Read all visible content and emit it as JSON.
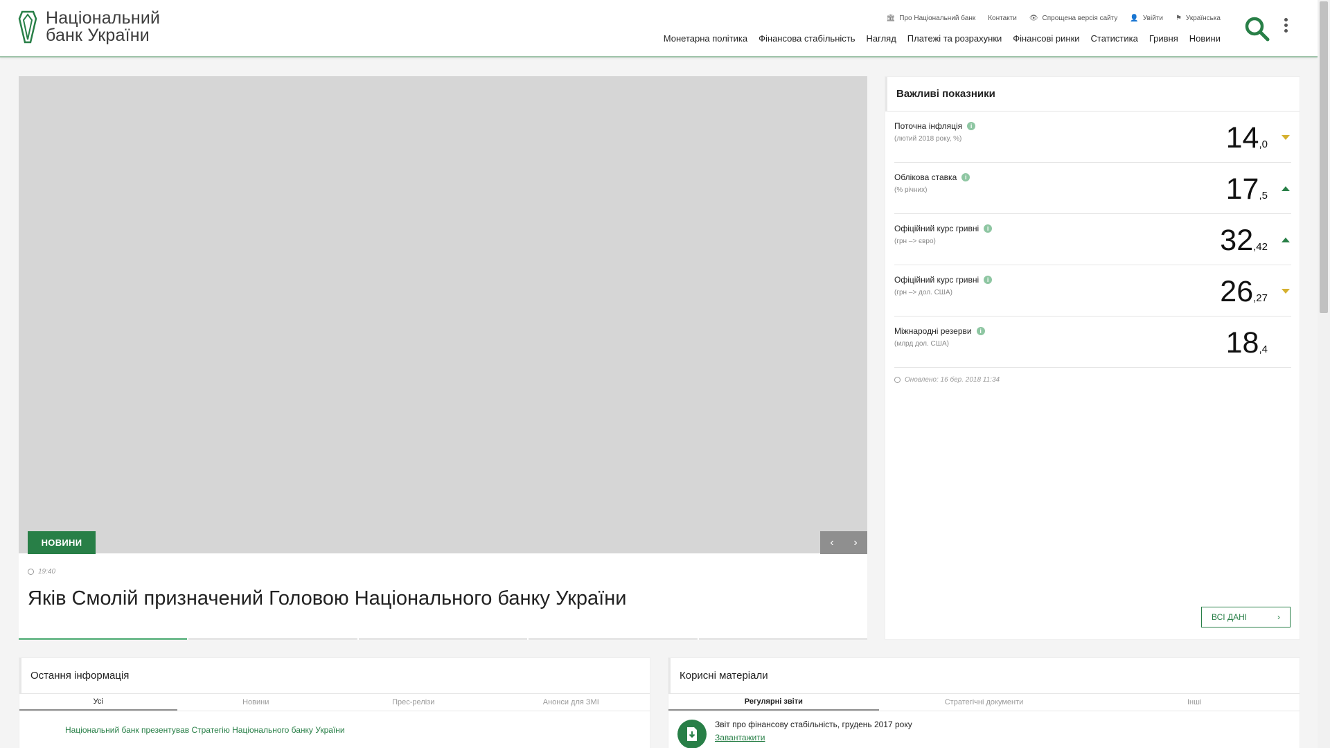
{
  "header": {
    "logo_line1": "Національний",
    "logo_line2": "банк України",
    "top_links": [
      {
        "icon": "bank-icon",
        "label": "Про Національний банк"
      },
      {
        "icon": "",
        "label": "Контакти"
      },
      {
        "icon": "eye-icon",
        "label": "Спрощена версія сайту"
      },
      {
        "icon": "user-icon",
        "label": "Увійти"
      },
      {
        "icon": "flag-icon",
        "label": "Українська"
      }
    ],
    "nav": [
      "Монетарна політика",
      "Фінансова стабільність",
      "Нагляд",
      "Платежі та розрахунки",
      "Фінансові ринки",
      "Статистика",
      "Гривня",
      "Новини"
    ]
  },
  "slider": {
    "badge": "НОВИНИ",
    "time": "19:40",
    "title": "Яків Смолій призначений Головою Національного банку України",
    "prev": "‹",
    "next": "›"
  },
  "indicators": {
    "title": "Важливі показники",
    "items": [
      {
        "label": "Поточна інфляція",
        "sub": "(лютий 2018 року, %)",
        "int": "14",
        "dec": ",0",
        "trend": "down"
      },
      {
        "label": "Облікова ставка",
        "sub": "(% річних)",
        "int": "17",
        "dec": ",5",
        "trend": "up"
      },
      {
        "label": "Офіційний курс гривні",
        "sub": "(грн –> євро)",
        "int": "32",
        "dec": ",42",
        "trend": "up"
      },
      {
        "label": "Офіційний курс гривні",
        "sub": "(грн –> дол. США)",
        "int": "26",
        "dec": ",27",
        "trend": "down"
      },
      {
        "label": "Міжнародні резерви",
        "sub": "(млрд дол. США)",
        "int": "18",
        "dec": ",4",
        "trend": "none"
      }
    ],
    "updated": "Оновлено: 16 бер. 2018 11:34",
    "all_data": "ВСІ ДАНІ",
    "all_data_arrow": "›"
  },
  "latest": {
    "title": "Остання інформація",
    "tabs": [
      "Усі",
      "Новини",
      "Прес-релізи",
      "Анонси для ЗМІ"
    ],
    "first_item": "Національний банк презентував Стратегію Національного банку України"
  },
  "useful": {
    "title": "Корисні матеріали",
    "tabs": [
      "Регулярні звіти",
      "Стратегічні документи",
      "Інші"
    ],
    "item_title": "Звіт про фінансову стабільність, грудень 2017 року",
    "item_link": "Завантажити"
  },
  "colors": {
    "brand_green": "#287f47",
    "accent_light_green": "#6fbb8e",
    "arrow_yellow": "#d5b02f"
  }
}
